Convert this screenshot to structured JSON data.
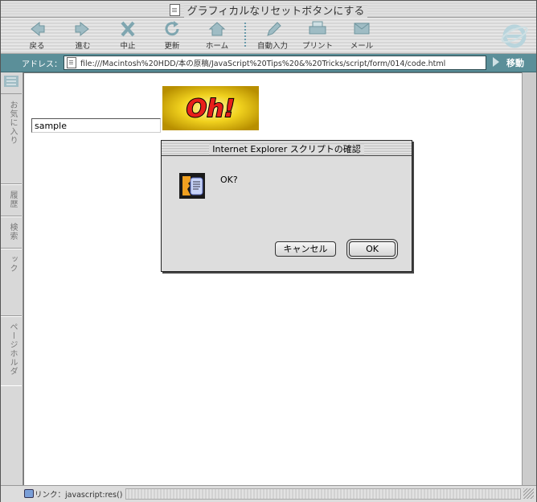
{
  "window": {
    "title": "グラフィカルなリセットボタンにする"
  },
  "toolbar": {
    "buttons": [
      {
        "label": "戻る",
        "icon": "back-arrow-icon"
      },
      {
        "label": "進む",
        "icon": "forward-arrow-icon"
      },
      {
        "label": "中止",
        "icon": "stop-x-icon"
      },
      {
        "label": "更新",
        "icon": "refresh-icon"
      },
      {
        "label": "ホーム",
        "icon": "home-icon"
      },
      {
        "label": "自動入力",
        "icon": "autofill-pencil-icon"
      },
      {
        "label": "プリント",
        "icon": "printer-icon"
      },
      {
        "label": "メール",
        "icon": "mail-icon"
      }
    ],
    "accent_color": "#5b8f99"
  },
  "address": {
    "label": "アドレス：",
    "url": "file:///Macintosh%20HDD/本の原稿/JavaScript%20Tips%20&%20Tricks/script/form/014/code.html",
    "go_label": "移動"
  },
  "sidebar": {
    "tabs": [
      "お気に入り",
      "履歴",
      "検索",
      "スクラップブック",
      "ページホルダ"
    ]
  },
  "page": {
    "input_value": "sample",
    "image_button_text": "Oh!"
  },
  "dialog": {
    "title": "Internet Explorer スクリプトの確認",
    "message": "OK?",
    "cancel_label": "キャンセル",
    "ok_label": "OK"
  },
  "status": {
    "text": "リンク：javascript:res()"
  }
}
